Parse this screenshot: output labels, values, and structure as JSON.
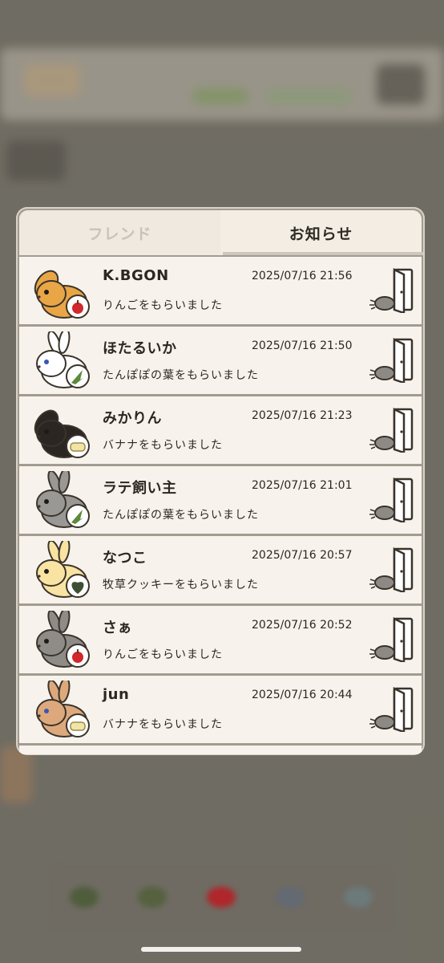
{
  "tabs": {
    "friend": "フレンド",
    "notice": "お知らせ"
  },
  "notifications": [
    {
      "name": "K.BGON",
      "time": "2025/07/16 21:56",
      "message": "りんごをもらいました",
      "gift": "apple-icon",
      "rabbit_color": "#e8a646"
    },
    {
      "name": "ほたるいか",
      "time": "2025/07/16 21:50",
      "message": "たんぽぽの葉をもらいました",
      "gift": "dandelion-leaf-icon",
      "rabbit_color": "#ffffff"
    },
    {
      "name": "みかりん",
      "time": "2025/07/16 21:23",
      "message": "バナナをもらいました",
      "gift": "banana-icon",
      "rabbit_color": "#2c2622"
    },
    {
      "name": "ラテ飼い主",
      "time": "2025/07/16 21:01",
      "message": "たんぽぽの葉をもらいました",
      "gift": "dandelion-leaf-icon",
      "rabbit_color": "#9a9894"
    },
    {
      "name": "なつこ",
      "time": "2025/07/16 20:57",
      "message": "牧草クッキーをもらいました",
      "gift": "hay-cookie-icon",
      "rabbit_color": "#f8e3a2"
    },
    {
      "name": "さぁ",
      "time": "2025/07/16 20:52",
      "message": "りんごをもらいました",
      "gift": "apple-icon",
      "rabbit_color": "#8f8c87"
    },
    {
      "name": "jun",
      "time": "2025/07/16 20:44",
      "message": "バナナをもらいました",
      "gift": "banana-icon",
      "rabbit_color": "#dda97c"
    }
  ],
  "colors": {
    "modal_border": "#a39b90",
    "row_bg": "#f7f3ec",
    "text": "#2b2824",
    "inactive_tab": "#c9c2b8"
  }
}
